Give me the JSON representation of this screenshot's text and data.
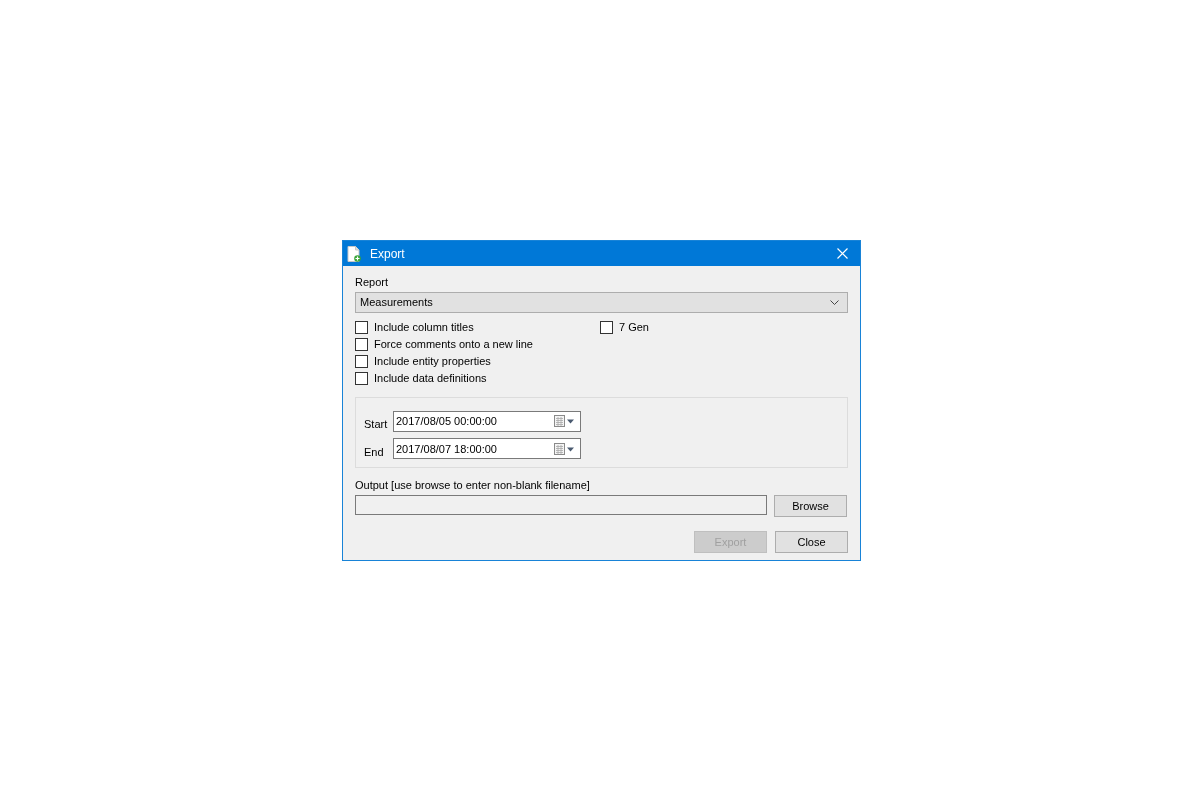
{
  "window": {
    "title": "Export"
  },
  "report": {
    "label": "Report",
    "value": "Measurements"
  },
  "options": [
    {
      "label": "Include column titles",
      "checked": false
    },
    {
      "label": "Force comments onto a new line",
      "checked": false
    },
    {
      "label": "Include entity properties",
      "checked": false
    },
    {
      "label": "Include data definitions",
      "checked": false
    }
  ],
  "extra_options": [
    {
      "label": "7 Gen",
      "checked": false
    }
  ],
  "date_range": [
    {
      "label": "Start",
      "value": "2017/08/05 00:00:00"
    },
    {
      "label": "End",
      "value": "2017/08/07 18:00:00"
    }
  ],
  "output": {
    "label": "Output [use browse to enter non-blank filename]",
    "disabled": true,
    "browse_button": {
      "label": "Browse",
      "disabled": false
    }
  },
  "footer_buttons": [
    {
      "label": "Export",
      "disabled": true
    },
    {
      "label": "Close",
      "disabled": false
    }
  ]
}
